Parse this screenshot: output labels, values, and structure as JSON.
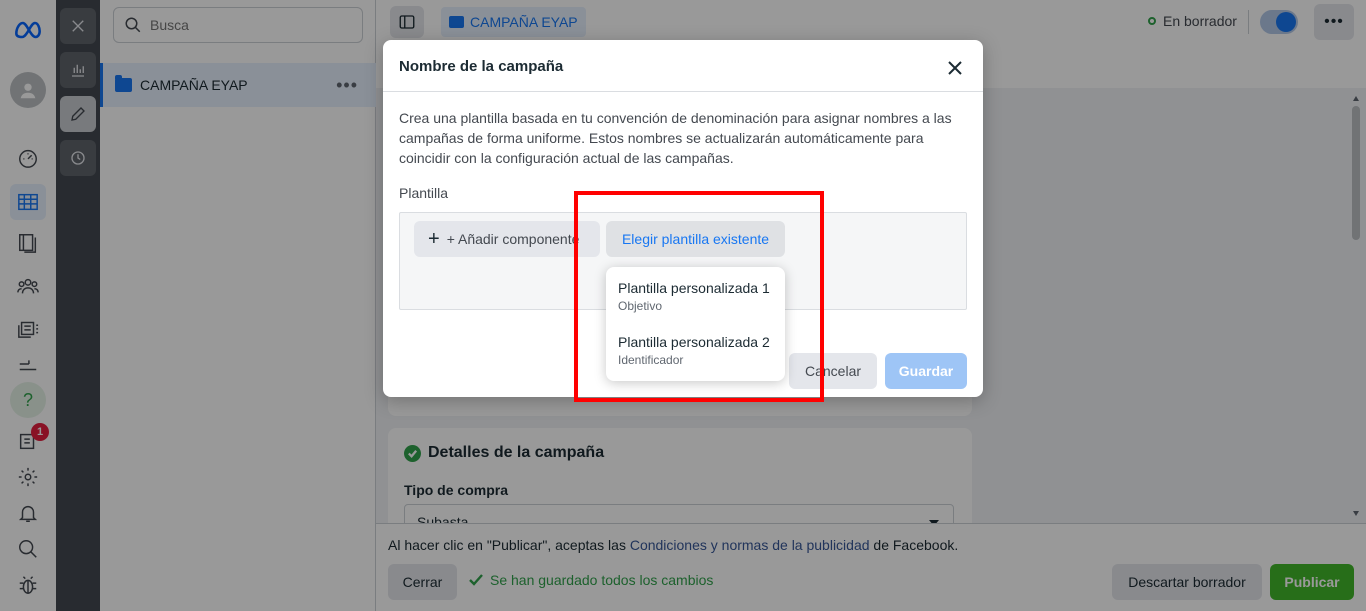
{
  "sidebar": {
    "badge_count": "1",
    "icons": [
      "meta-logo-icon",
      "avatar",
      "dashboard-icon",
      "table-icon",
      "pages-icon",
      "audiences-icon",
      "ads-library-icon",
      "billing-icon",
      "help-icon",
      "notifications-icon",
      "settings-icon",
      "bell-icon",
      "search-icon",
      "bug-icon"
    ]
  },
  "tree": {
    "search_placeholder": "Busca",
    "campaign_label": "CAMPAÑA EYAP"
  },
  "header": {
    "breadcrumb": "CAMPAÑA EYAP",
    "status": "En borrador"
  },
  "details": {
    "title": "Detalles de la campaña",
    "purchase_type_label": "Tipo de compra",
    "purchase_type_value": "Subasta"
  },
  "footer": {
    "legal_prefix": "Al hacer clic en \"Publicar\", aceptas las ",
    "legal_link": "Condiciones y normas de la publicidad",
    "legal_suffix": " de Facebook.",
    "close_label": "Cerrar",
    "saved_text": "Se han guardado todos los cambios",
    "discard_label": "Descartar borrador",
    "publish_label": "Publicar"
  },
  "modal": {
    "title": "Nombre de la campaña",
    "description": "Crea una plantilla basada en tu convención de denominación para asignar nombres a las campañas de forma uniforme. Estos nombres se actualizarán automáticamente para coincidir con la configuración actual de las campañas.",
    "template_label": "Plantilla",
    "add_component_label": "+ Añadir componente",
    "choose_template_label": "Elegir plantilla existente",
    "cancel_label": "Cancelar",
    "save_label": "Guardar",
    "dropdown": [
      {
        "name": "Plantilla personalizada 1",
        "sub": "Objetivo"
      },
      {
        "name": "Plantilla personalizada 2",
        "sub": "Identificador"
      }
    ]
  },
  "colors": {
    "accent": "#1877f2",
    "publish": "#42b72a",
    "highlight": "#ff0000"
  }
}
